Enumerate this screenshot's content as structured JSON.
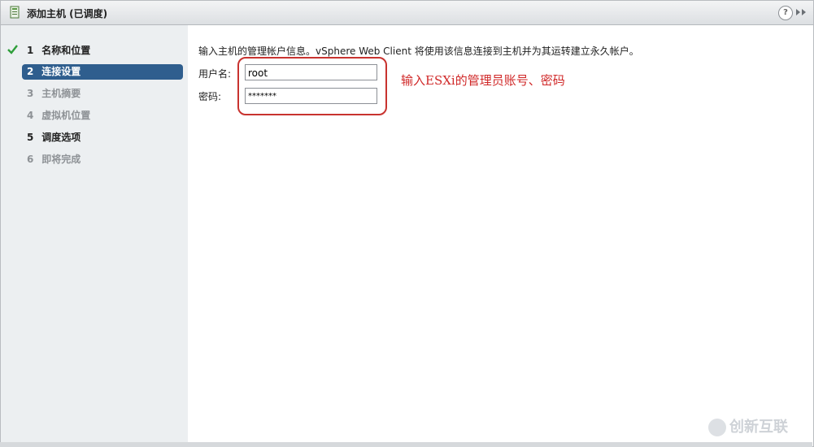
{
  "window": {
    "title": "添加主机 (已调度)",
    "help_symbol": "?"
  },
  "steps": [
    {
      "number": "1",
      "label": "名称和位置",
      "state": "done"
    },
    {
      "number": "2",
      "label": "连接设置",
      "state": "active"
    },
    {
      "number": "3",
      "label": "主机摘要",
      "state": "disabled"
    },
    {
      "number": "4",
      "label": "虚拟机位置",
      "state": "disabled"
    },
    {
      "number": "5",
      "label": "调度选项",
      "state": "bold"
    },
    {
      "number": "6",
      "label": "即将完成",
      "state": "disabled"
    }
  ],
  "form": {
    "instruction": "输入主机的管理帐户信息。vSphere Web Client 将使用该信息连接到主机并为其运转建立永久帐户。",
    "username_label": "用户名:",
    "username_value": "root",
    "password_label": "密码:",
    "password_value": "*******"
  },
  "annotation": "输入ESXi的管理员账号、密码",
  "watermark": "创新互联",
  "colors": {
    "active_step": "#2f5e8e",
    "annotation": "#d02828",
    "check": "#2e9e3a"
  }
}
